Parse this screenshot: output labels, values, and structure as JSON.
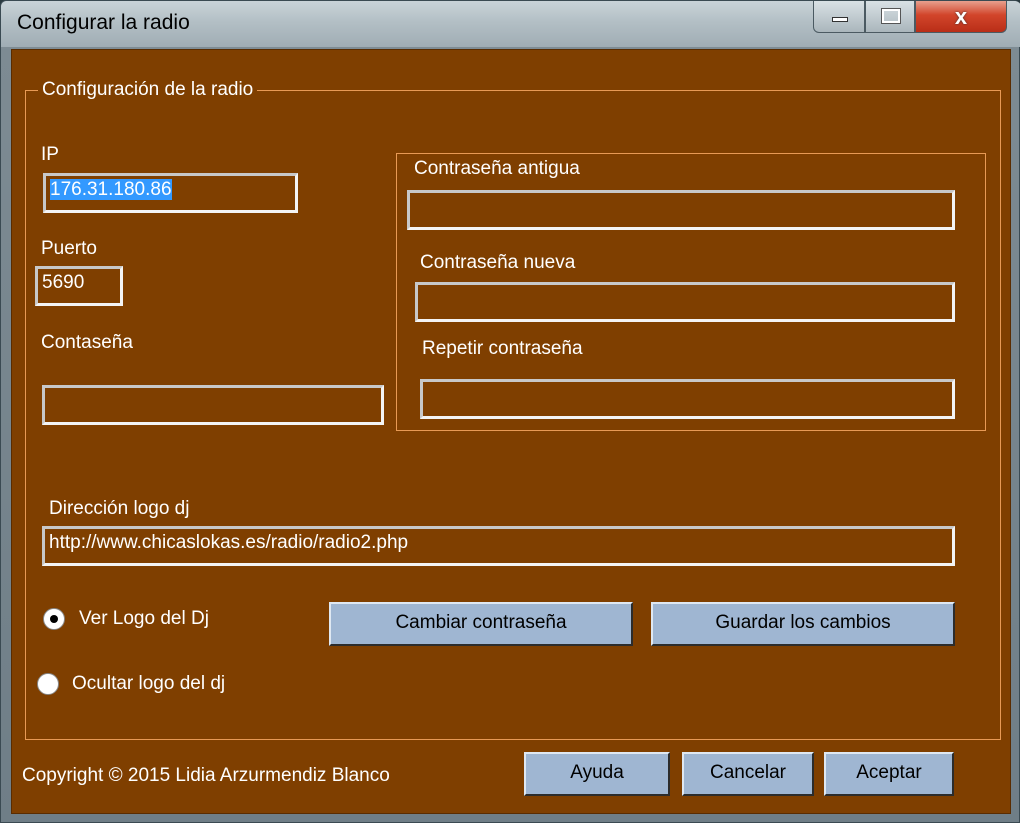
{
  "window": {
    "title": "Configurar la radio",
    "minimize_icon": "minimize-icon",
    "maximize_icon": "maximize-icon",
    "close_icon": "close-icon",
    "close_glyph": "x"
  },
  "config_group": {
    "legend": "Configuración de la radio"
  },
  "ip": {
    "label": "IP",
    "value": "176.31.180.86"
  },
  "port": {
    "label": "Puerto",
    "value": "5690"
  },
  "password": {
    "label": "Contaseña",
    "value": ""
  },
  "change_password_group": {
    "old_label": "Contraseña antigua",
    "old_value": "",
    "new_label": "Contraseña nueva",
    "new_value": "",
    "repeat_label": "Repetir contraseña",
    "repeat_value": ""
  },
  "dj_logo": {
    "label": "Dirección logo dj",
    "value": "http://www.chicaslokas.es/radio/radio2.php"
  },
  "radios": {
    "show_logo": {
      "label": "Ver Logo del Dj",
      "checked": true
    },
    "hide_logo": {
      "label": "Ocultar logo del dj",
      "checked": false
    }
  },
  "buttons": {
    "change_password": "Cambiar contraseña",
    "save_changes": "Guardar los cambios",
    "help": "Ayuda",
    "cancel": "Cancelar",
    "accept": "Aceptar"
  },
  "footer": {
    "copyright": "Copyright © 2015 Lidia Arzurmendiz Blanco"
  },
  "colors": {
    "background": "#7f3f00",
    "group_border": "#e89a55",
    "button": "#9fb6d2",
    "selection": "#3399ff"
  }
}
